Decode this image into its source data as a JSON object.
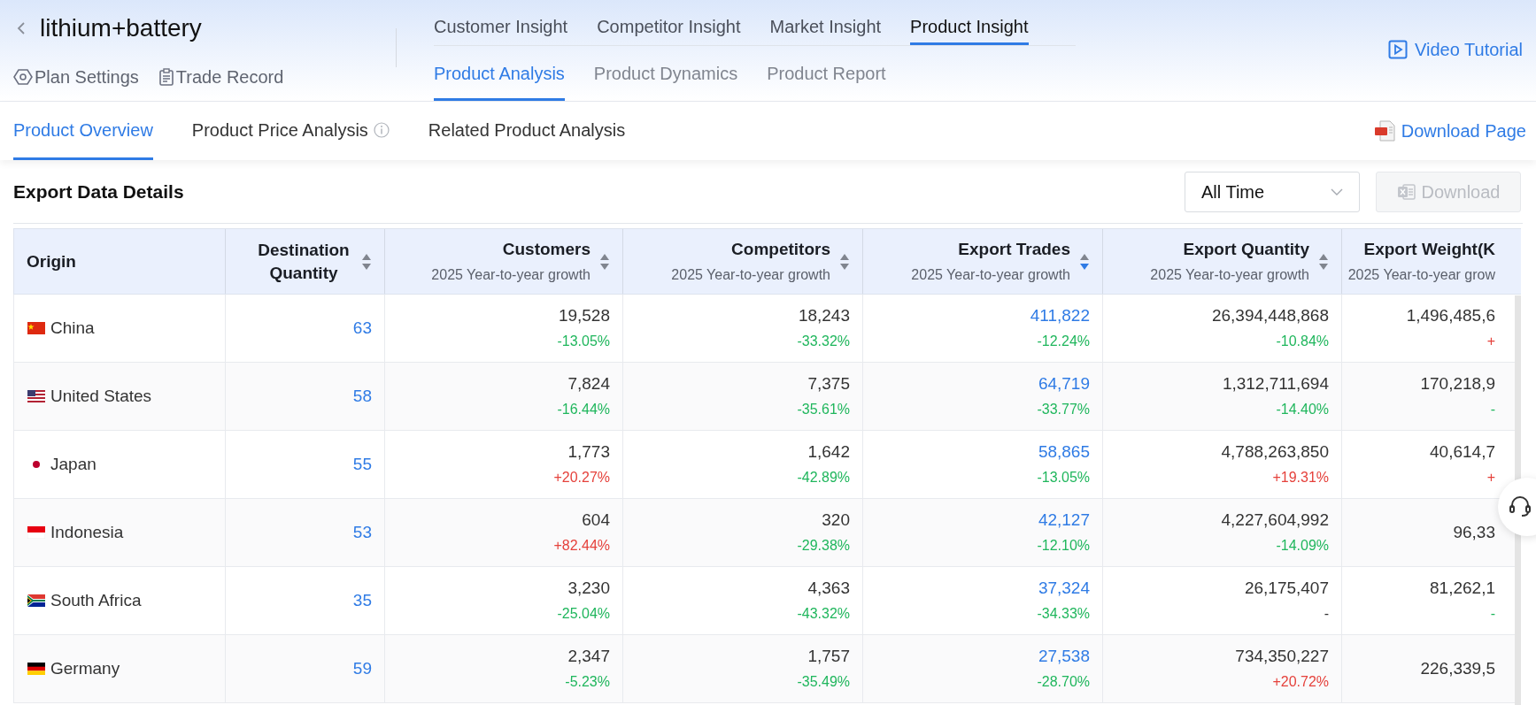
{
  "header": {
    "title": "lithium+battery",
    "actions": [
      {
        "label": "Plan Settings",
        "kind": "settings"
      },
      {
        "label": "Trade Record",
        "kind": "record"
      }
    ],
    "nav_tabs": [
      {
        "label": "Customer Insight",
        "selected": false
      },
      {
        "label": "Competitor Insight",
        "selected": false
      },
      {
        "label": "Market Insight",
        "selected": false
      },
      {
        "label": "Product Insight",
        "selected": true
      }
    ],
    "sub_tabs": [
      {
        "label": "Product Analysis",
        "selected": true
      },
      {
        "label": "Product Dynamics",
        "selected": false
      },
      {
        "label": "Product Report",
        "selected": false
      }
    ],
    "video_tutorial": "Video Tutorial"
  },
  "page_tabs": [
    {
      "label": "Product Overview",
      "selected": true,
      "info": false
    },
    {
      "label": "Product Price Analysis",
      "selected": false,
      "info": true
    },
    {
      "label": "Related Product Analysis",
      "selected": false,
      "info": false
    }
  ],
  "download_page": "Download Page",
  "section": {
    "title": "Export Data Details",
    "period_select": {
      "value": "All Time"
    },
    "download_button": {
      "label": "Download",
      "disabled": true
    }
  },
  "table": {
    "columns": [
      {
        "title": "Origin",
        "sortable": false
      },
      {
        "title": "Destination Quantity",
        "link": true,
        "sortable": true,
        "sorted_desc": false
      },
      {
        "title": "Customers",
        "subtitle": "2025 Year-to-year growth",
        "link": false,
        "sortable": true,
        "sorted_desc": false
      },
      {
        "title": "Competitors",
        "subtitle": "2025 Year-to-year growth",
        "link": false,
        "sortable": true,
        "sorted_desc": false
      },
      {
        "title": "Export Trades",
        "subtitle": "2025 Year-to-year growth",
        "link": true,
        "sortable": true,
        "sorted_desc": true
      },
      {
        "title": "Export Quantity",
        "subtitle": "2025 Year-to-year growth",
        "link": false,
        "sortable": true,
        "sorted_desc": false
      },
      {
        "title": "Export Weight(K",
        "subtitle": "2025 Year-to-year grow",
        "sortable": false
      }
    ],
    "rows": [
      {
        "cells": [
          {
            "value": "China",
            "kind": "cn"
          },
          {
            "value": "63"
          },
          {
            "value": "19,528",
            "growth": "-13.05%",
            "kind": "down"
          },
          {
            "value": "18,243",
            "growth": "-33.32%",
            "kind": "down"
          },
          {
            "value": "411,822",
            "growth": "-12.24%",
            "kind": "down"
          },
          {
            "value": "26,394,448,868",
            "growth": "-10.84%",
            "kind": "down"
          },
          {
            "value": "1,496,485,6",
            "growth": "+",
            "kind": "up"
          }
        ]
      },
      {
        "cells": [
          {
            "value": "United States",
            "kind": "us"
          },
          {
            "value": "58"
          },
          {
            "value": "7,824",
            "growth": "-16.44%",
            "kind": "down"
          },
          {
            "value": "7,375",
            "growth": "-35.61%",
            "kind": "down"
          },
          {
            "value": "64,719",
            "growth": "-33.77%",
            "kind": "down"
          },
          {
            "value": "1,312,711,694",
            "growth": "-14.40%",
            "kind": "down"
          },
          {
            "value": "170,218,9",
            "growth": "-",
            "kind": "down"
          }
        ]
      },
      {
        "cells": [
          {
            "value": "Japan",
            "kind": "jp"
          },
          {
            "value": "55"
          },
          {
            "value": "1,773",
            "growth": "+20.27%",
            "kind": "up"
          },
          {
            "value": "1,642",
            "growth": "-42.89%",
            "kind": "down"
          },
          {
            "value": "58,865",
            "growth": "-13.05%",
            "kind": "down"
          },
          {
            "value": "4,788,263,850",
            "growth": "+19.31%",
            "kind": "up"
          },
          {
            "value": "40,614,7",
            "growth": "+",
            "kind": "up"
          }
        ]
      },
      {
        "cells": [
          {
            "value": "Indonesia",
            "kind": "id"
          },
          {
            "value": "53"
          },
          {
            "value": "604",
            "growth": "+82.44%",
            "kind": "up"
          },
          {
            "value": "320",
            "growth": "-29.38%",
            "kind": "down"
          },
          {
            "value": "42,127",
            "growth": "-12.10%",
            "kind": "down"
          },
          {
            "value": "4,227,604,992",
            "growth": "-14.09%",
            "kind": "down"
          },
          {
            "value": "96,33"
          }
        ]
      },
      {
        "cells": [
          {
            "value": "South Africa",
            "kind": "za"
          },
          {
            "value": "35"
          },
          {
            "value": "3,230",
            "growth": "-25.04%",
            "kind": "down"
          },
          {
            "value": "4,363",
            "growth": "-43.32%",
            "kind": "down"
          },
          {
            "value": "37,324",
            "growth": "-34.33%",
            "kind": "down"
          },
          {
            "value": "26,175,407",
            "growth": "-",
            "kind": "flat"
          },
          {
            "value": "81,262,1",
            "growth": "-",
            "kind": "down"
          }
        ]
      },
      {
        "cells": [
          {
            "value": "Germany",
            "kind": "de"
          },
          {
            "value": "59"
          },
          {
            "value": "2,347",
            "growth": "-5.23%",
            "kind": "down"
          },
          {
            "value": "1,757",
            "growth": "-35.49%",
            "kind": "down"
          },
          {
            "value": "27,538",
            "growth": "-28.70%",
            "kind": "down"
          },
          {
            "value": "734,350,227",
            "growth": "+20.72%",
            "kind": "up"
          },
          {
            "value": "226,339,5"
          }
        ]
      }
    ]
  }
}
